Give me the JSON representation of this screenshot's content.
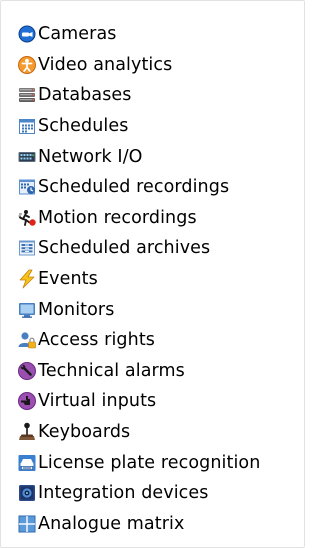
{
  "tree": {
    "items": [
      {
        "label": "Cameras",
        "icon": "camera-icon"
      },
      {
        "label": "Video analytics",
        "icon": "video-analytics-icon"
      },
      {
        "label": "Databases",
        "icon": "database-icon"
      },
      {
        "label": "Schedules",
        "icon": "schedule-icon"
      },
      {
        "label": "Network I/O",
        "icon": "network-io-icon"
      },
      {
        "label": "Scheduled recordings",
        "icon": "scheduled-recording-icon"
      },
      {
        "label": "Motion recordings",
        "icon": "motion-recording-icon"
      },
      {
        "label": "Scheduled archives",
        "icon": "scheduled-archive-icon"
      },
      {
        "label": "Events",
        "icon": "lightning-icon"
      },
      {
        "label": "Monitors",
        "icon": "monitor-icon"
      },
      {
        "label": "Access rights",
        "icon": "user-lock-icon"
      },
      {
        "label": "Technical alarms",
        "icon": "wrench-icon"
      },
      {
        "label": "Virtual inputs",
        "icon": "pointing-hand-icon"
      },
      {
        "label": "Keyboards",
        "icon": "joystick-icon"
      },
      {
        "label": "License plate recognition",
        "icon": "license-plate-icon"
      },
      {
        "label": "Integration devices",
        "icon": "integration-device-icon"
      },
      {
        "label": "Analogue matrix",
        "icon": "matrix-grid-icon"
      }
    ]
  }
}
